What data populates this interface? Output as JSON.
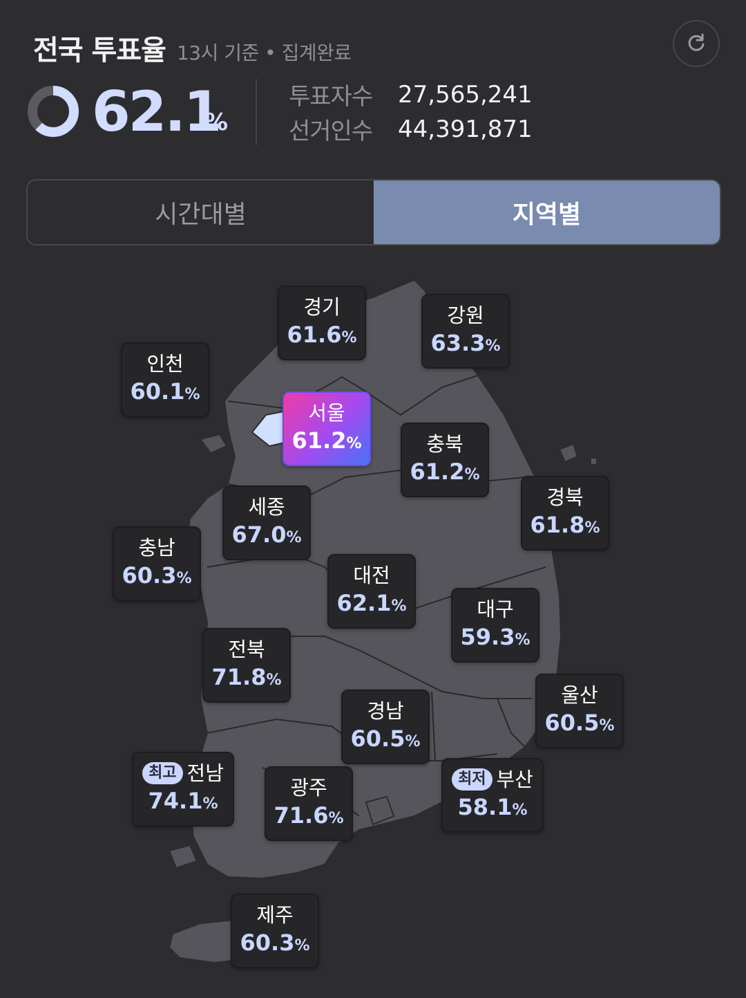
{
  "header": {
    "title": "전국 투표율",
    "subtitle": "13시 기준 • 집계완료"
  },
  "summary": {
    "rate": "62.1",
    "unit": "%",
    "rate_fraction": 0.621,
    "voters_label": "투표자수",
    "voters_value": "27,565,241",
    "electorate_label": "선거인수",
    "electorate_value": "44,391,871"
  },
  "tabs": [
    {
      "label": "시간대별",
      "selected": false
    },
    {
      "label": "지역별",
      "selected": true
    }
  ],
  "regions": [
    {
      "name": "경기",
      "rate": "61.6",
      "unit": "%"
    },
    {
      "name": "강원",
      "rate": "63.3",
      "unit": "%"
    },
    {
      "name": "인천",
      "rate": "60.1",
      "unit": "%"
    },
    {
      "name": "서울",
      "rate": "61.2",
      "unit": "%",
      "selected": true
    },
    {
      "name": "충북",
      "rate": "61.2",
      "unit": "%"
    },
    {
      "name": "경북",
      "rate": "61.8",
      "unit": "%"
    },
    {
      "name": "세종",
      "rate": "67.0",
      "unit": "%"
    },
    {
      "name": "충남",
      "rate": "60.3",
      "unit": "%"
    },
    {
      "name": "대전",
      "rate": "62.1",
      "unit": "%"
    },
    {
      "name": "대구",
      "rate": "59.3",
      "unit": "%"
    },
    {
      "name": "전북",
      "rate": "71.8",
      "unit": "%"
    },
    {
      "name": "울산",
      "rate": "60.5",
      "unit": "%"
    },
    {
      "name": "경남",
      "rate": "60.5",
      "unit": "%"
    },
    {
      "name": "전남",
      "rate": "74.1",
      "unit": "%",
      "badge": "최고"
    },
    {
      "name": "광주",
      "rate": "71.6",
      "unit": "%"
    },
    {
      "name": "부산",
      "rate": "58.1",
      "unit": "%",
      "badge": "최저"
    },
    {
      "name": "제주",
      "rate": "60.3",
      "unit": "%"
    }
  ],
  "colors": {
    "background": "#2d2d30",
    "accent": "#d2dcff",
    "tab_selected": "#7a8bb0",
    "map_fill": "#55555b",
    "highlight_gradient": [
      "#f03aa8",
      "#4a72f5"
    ]
  },
  "icons": {
    "refresh": "refresh-icon",
    "donut": "donut-progress-icon"
  }
}
